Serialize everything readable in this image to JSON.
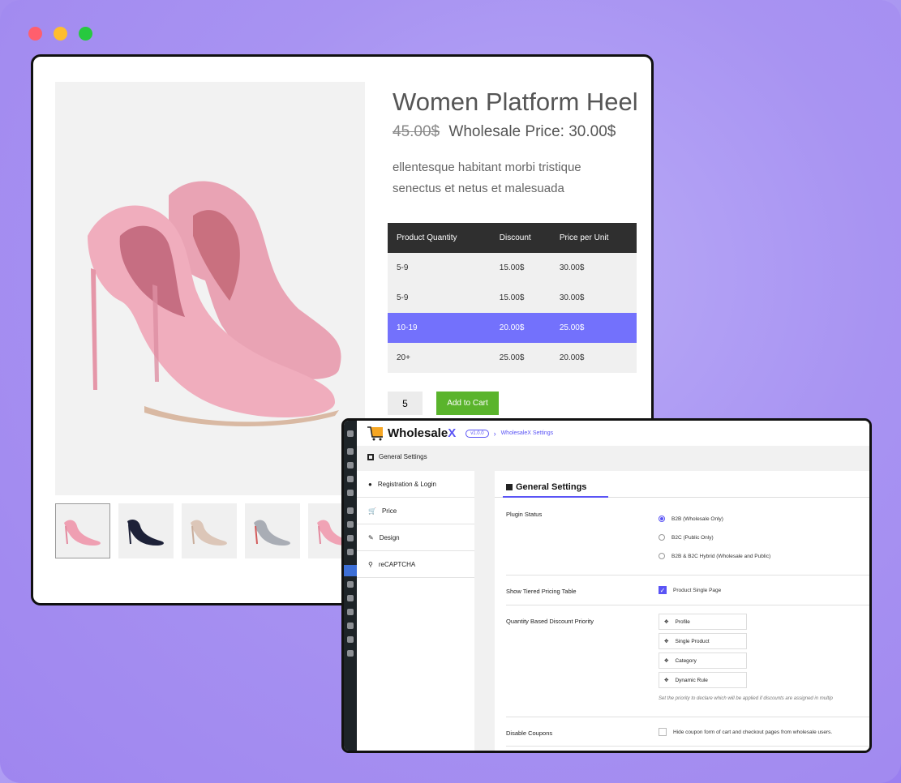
{
  "product": {
    "title": "Women Platform Heel",
    "old_price": "45.00$",
    "wholesale_price": "Wholesale Price: 30.00$",
    "description": "ellentesque habitant morbi tristique senectus et netus et malesuada",
    "table": {
      "headers": [
        "Product Quantity",
        "Discount",
        "Price per Unit"
      ],
      "rows": [
        [
          "5-9",
          "15.00$",
          "30.00$"
        ],
        [
          "5-9",
          "15.00$",
          "30.00$"
        ],
        [
          "10-19",
          "20.00$",
          "25.00$"
        ],
        [
          "20+",
          "25.00$",
          "20.00$"
        ]
      ]
    },
    "quantity": "5",
    "add_to_cart": "Add to Cart",
    "colors": {
      "accent": "#7371fc",
      "button": "#5ab42c"
    }
  },
  "settings": {
    "brand": "WholesaleX",
    "brand_prefix": "Wholesale",
    "brand_x": "X",
    "version": "v1.0.0",
    "breadcrumb": "WholesaleX Settings",
    "page_heading": "General Settings",
    "nav": [
      {
        "label": "Registration & Login",
        "icon": "user-icon"
      },
      {
        "label": "Price",
        "icon": "cart-icon"
      },
      {
        "label": "Design",
        "icon": "brush-icon"
      },
      {
        "label": "reCAPTCHA",
        "icon": "key-icon"
      }
    ],
    "panel_title": "General Settings",
    "plugin_status": {
      "label": "Plugin Status",
      "options": [
        "B2B (Wholesale Only)",
        "B2C (Public Only)",
        "B2B & B2C Hybrid (Wholesale and Public)"
      ],
      "selected": "B2B (Wholesale Only)"
    },
    "tiered_table": {
      "label": "Show Tiered Pricing Table",
      "option": "Product Single Page",
      "checked": true
    },
    "priority": {
      "label": "Quantity Based Discount Priority",
      "items": [
        "Profile",
        "Single Product",
        "Category",
        "Dynamic Rule"
      ],
      "help": "Set the priority to declare which will be applied if discounts are assigned in multip"
    },
    "coupons": {
      "label": "Disable Coupons",
      "option": "Hide coupon form of cart and checkout pages from wholesale users.",
      "checked": false
    },
    "accent_color": "#5a54f5"
  }
}
